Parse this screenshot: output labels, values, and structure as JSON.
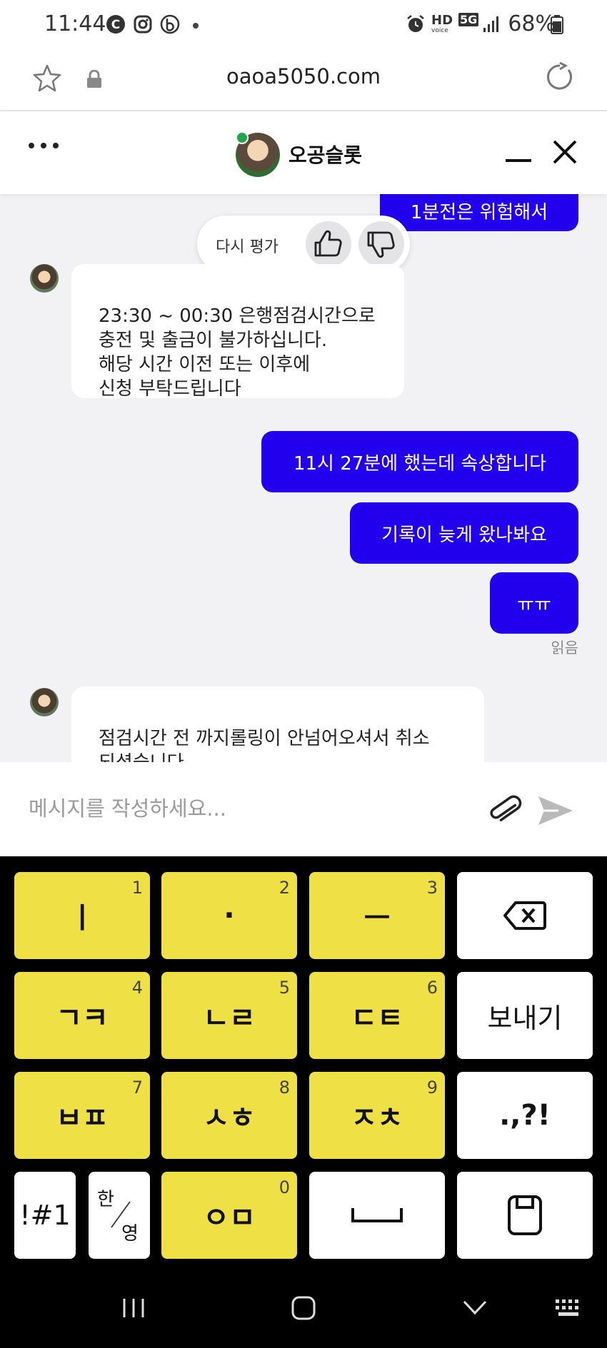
{
  "status_bar": {
    "time": "11:44",
    "battery": "68%",
    "icons": [
      "c-app-icon",
      "instagram-icon",
      "b-app-icon",
      "dot-icon",
      "alarm-icon",
      "hd-voice-icon",
      "5g-icon",
      "signal-icon",
      "battery-icon"
    ],
    "hd_text": "HD",
    "voice_text": "voice",
    "net_text": "5G"
  },
  "browser": {
    "url": "oaoa5050.com"
  },
  "chat_header": {
    "title": "오공슬롯",
    "online_color": "#1fa84a"
  },
  "rating": {
    "label": "다시 평가"
  },
  "messages": [
    {
      "sender": "me",
      "text": "1분전은 위험해서"
    },
    {
      "sender": "bot",
      "text": "23:30 ~ 00:30 은행점검시간으로\n충전 및 출금이 불가하십니다.\n해당 시간 이전 또는 이후에\n신청 부탁드립니다"
    },
    {
      "sender": "me",
      "text": "11시 27분에 했는데 속상합니다"
    },
    {
      "sender": "me",
      "text": "기록이 늦게 왔나봐요"
    },
    {
      "sender": "me",
      "text": "ㅠㅠ"
    },
    {
      "sender": "bot",
      "text": "점검시간 전 까지롤링이 안넘어오셔서 취소\n되셨습니다"
    }
  ],
  "read_label": "읽음",
  "input": {
    "placeholder": "메시지를 작성하세요..."
  },
  "keyboard": {
    "rows": [
      [
        {
          "label": "ㅣ",
          "num": "1"
        },
        {
          "label": "·",
          "num": "2"
        },
        {
          "label": "ㅡ",
          "num": "3"
        },
        {
          "label": "",
          "icon": "backspace-icon"
        }
      ],
      [
        {
          "label": "ㄱㅋ",
          "num": "4"
        },
        {
          "label": "ㄴㄹ",
          "num": "5"
        },
        {
          "label": "ㄷㅌ",
          "num": "6"
        },
        {
          "label": "보내기"
        }
      ],
      [
        {
          "label": "ㅂㅍ",
          "num": "7"
        },
        {
          "label": "ㅅㅎ",
          "num": "8"
        },
        {
          "label": "ㅈㅊ",
          "num": "9"
        },
        {
          "label": ".,?!"
        }
      ],
      [
        {
          "label": "!#1"
        },
        {
          "label_top": "한",
          "label_bottom": "영"
        },
        {
          "label": "ㅇㅁ",
          "num": "0"
        },
        {
          "label": "",
          "icon": "space-icon"
        },
        {
          "label": "",
          "icon": "clipboard-icon"
        }
      ]
    ],
    "yellow": "#efe045",
    "white": "#ffffff"
  },
  "colors": {
    "my_bubble": "#2200ee",
    "chat_bg": "#f2f2f4"
  }
}
